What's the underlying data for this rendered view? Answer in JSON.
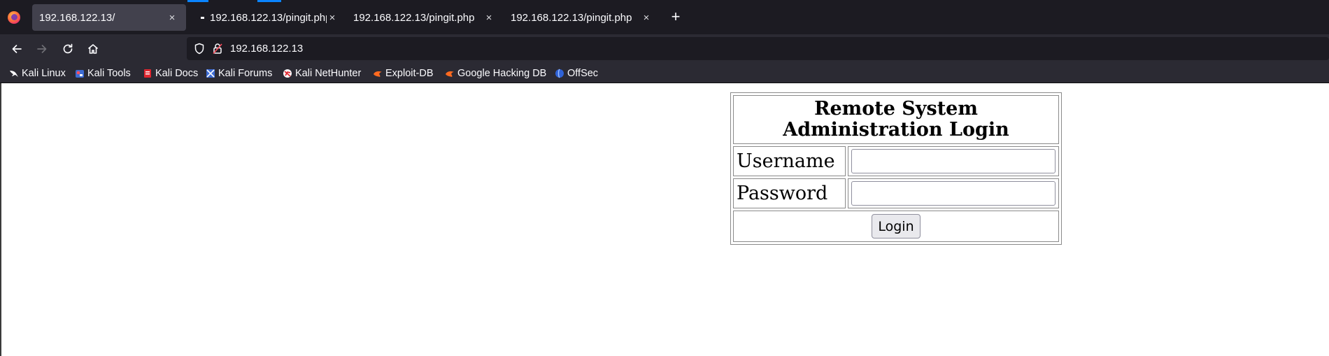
{
  "browser": {
    "tabs": [
      {
        "title": "192.168.122.13/",
        "close": "×"
      },
      {
        "title": "192.168.122.13/pingit.php",
        "close": "×"
      },
      {
        "title": "192.168.122.13/pingit.php",
        "close": "×"
      },
      {
        "title": "192.168.122.13/pingit.php",
        "close": "×"
      }
    ],
    "new_tab": "+",
    "url": "192.168.122.13",
    "accent_color": "#0a84ff"
  },
  "bookmarks": [
    {
      "label": "Kali Linux",
      "icon": "kali-dragon-icon"
    },
    {
      "label": "Kali Tools",
      "icon": "kali-tools-icon"
    },
    {
      "label": "Kali Docs",
      "icon": "kali-docs-icon"
    },
    {
      "label": "Kali Forums",
      "icon": "kali-forums-icon"
    },
    {
      "label": "Kali NetHunter",
      "icon": "kali-nethunter-icon"
    },
    {
      "label": "Exploit-DB",
      "icon": "exploit-db-icon"
    },
    {
      "label": "Google Hacking DB",
      "icon": "google-hacking-db-icon"
    },
    {
      "label": "OffSec",
      "icon": "offsec-icon"
    }
  ],
  "page": {
    "heading": "Remote System Administration Login",
    "username_label": "Username",
    "password_label": "Password",
    "username_value": "",
    "password_value": "",
    "login_button": "Login"
  }
}
